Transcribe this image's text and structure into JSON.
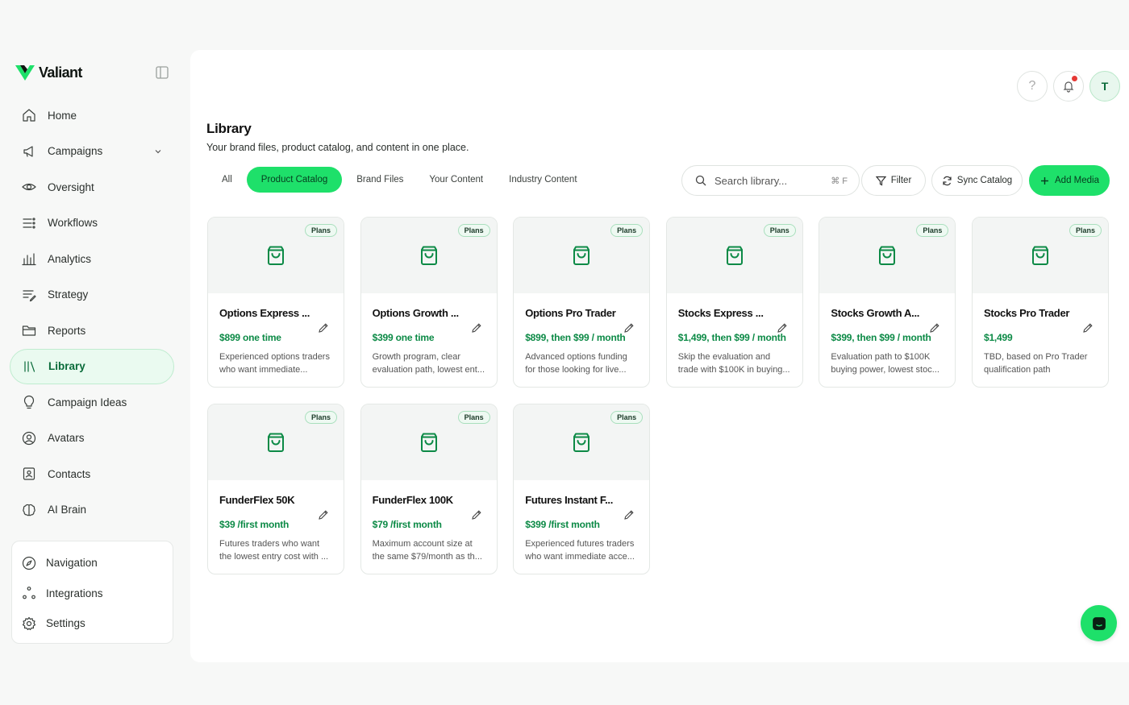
{
  "brand": {
    "name": "Valiant"
  },
  "colors": {
    "accent": "#1ee06a",
    "accent_dark": "#0a6b3a",
    "price": "#0c8a46",
    "notif": "#e53935"
  },
  "sidebar": {
    "items": [
      {
        "label": "Home",
        "icon": "home-icon"
      },
      {
        "label": "Campaigns",
        "icon": "megaphone-icon",
        "has_chevron": true
      },
      {
        "label": "Oversight",
        "icon": "eye-icon"
      },
      {
        "label": "Workflows",
        "icon": "workflow-icon"
      },
      {
        "label": "Analytics",
        "icon": "bar-chart-icon"
      },
      {
        "label": "Strategy",
        "icon": "strategy-icon"
      },
      {
        "label": "Reports",
        "icon": "folder-icon"
      },
      {
        "label": "Library",
        "icon": "library-icon",
        "active": true
      },
      {
        "label": "Campaign Ideas",
        "icon": "lightbulb-icon"
      },
      {
        "label": "Avatars",
        "icon": "user-circle-icon"
      },
      {
        "label": "Contacts",
        "icon": "contact-card-icon"
      },
      {
        "label": "AI Brain",
        "icon": "brain-icon"
      }
    ],
    "bottom": [
      {
        "label": "Navigation",
        "icon": "compass-icon"
      },
      {
        "label": "Integrations",
        "icon": "integrations-icon"
      },
      {
        "label": "Settings",
        "icon": "gear-icon"
      }
    ]
  },
  "header": {
    "help": "?",
    "avatar_initial": "T"
  },
  "page": {
    "title": "Library",
    "subtitle": "Your brand files, product catalog, and content in one place."
  },
  "tabs": [
    {
      "label": "All"
    },
    {
      "label": "Product Catalog",
      "active": true
    },
    {
      "label": "Brand Files"
    },
    {
      "label": "Your Content"
    },
    {
      "label": "Industry Content"
    }
  ],
  "toolbar": {
    "search_placeholder": "Search library...",
    "search_shortcut": "⌘ F",
    "filter_label": "Filter",
    "sync_label": "Sync Catalog",
    "add_label": "Add Media"
  },
  "products": [
    {
      "badge": "Plans",
      "title": "Options Express ...",
      "price": "$899 one time",
      "desc": "Experienced options traders who want immediate..."
    },
    {
      "badge": "Plans",
      "title": "Options Growth ...",
      "price": "$399 one time",
      "desc": "Growth program, clear evaluation path, lowest ent..."
    },
    {
      "badge": "Plans",
      "title": "Options Pro Trader",
      "price": "$899, then $99 / month",
      "desc": "Advanced options funding for those looking for live..."
    },
    {
      "badge": "Plans",
      "title": "Stocks Express ...",
      "price": "$1,499, then $99 / month",
      "desc": "Skip the evaluation and trade with $100K in buying..."
    },
    {
      "badge": "Plans",
      "title": "Stocks Growth A...",
      "price": "$399, then $99 / month",
      "desc": "Evaluation path to $100K buying power, lowest stoc..."
    },
    {
      "badge": "Plans",
      "title": "Stocks Pro Trader",
      "price": "$1,499",
      "desc": "TBD, based on Pro Trader qualification path"
    },
    {
      "badge": "Plans",
      "title": "FunderFlex 50K",
      "price": "$39 /first month",
      "desc": "Futures traders who want the lowest entry cost with ..."
    },
    {
      "badge": "Plans",
      "title": "FunderFlex 100K",
      "price": "$79 /first month",
      "desc": "Maximum account size at the same $79/month as th..."
    },
    {
      "badge": "Plans",
      "title": "Futures Instant F...",
      "price": "$399 /first month",
      "desc": "Experienced futures traders who want immediate acce..."
    }
  ]
}
